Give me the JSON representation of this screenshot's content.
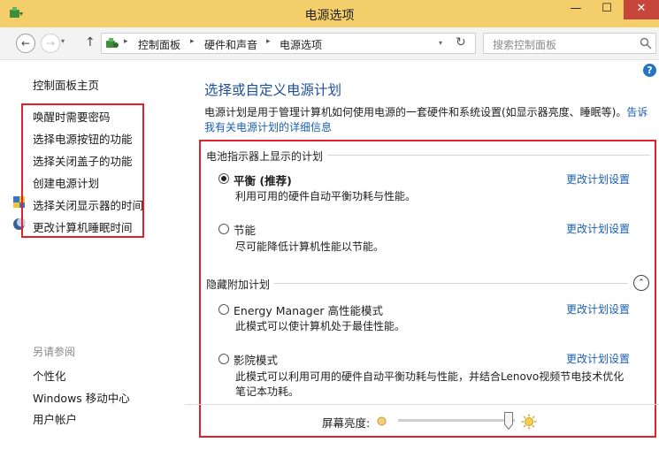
{
  "window": {
    "title": "电源选项",
    "minimize": "—",
    "maximize": "☐",
    "close": "✕"
  },
  "nav": {
    "back": "←",
    "forward": "→",
    "recent": "▾",
    "up": "↑",
    "breadcrumbs": [
      "控制面板",
      "硬件和声音",
      "电源选项"
    ],
    "crumb_separator": "▸",
    "refresh": "↻",
    "address_dropdown": "▾"
  },
  "search": {
    "placeholder": "搜索控制面板"
  },
  "help_label": "?",
  "sidebar": {
    "home": "控制面板主页",
    "tasks": [
      "唤醒时需要密码",
      "选择电源按钮的功能",
      "选择关闭盖子的功能",
      "创建电源计划",
      "选择关闭显示器的时间",
      "更改计算机睡眠时间"
    ],
    "see_also_title": "另请参阅",
    "see_also": [
      "个性化",
      "Windows 移动中心",
      "用户帐户"
    ]
  },
  "main": {
    "title": "选择或自定义电源计划",
    "description_text": "电源计划是用于管理计算机如何使用电源的一套硬件和系统设置(如显示器亮度、睡眠等)。",
    "description_link": "告诉我有关电源计划的详细信息",
    "battery_group_title": "电池指示器上显示的计划",
    "hidden_group_title": "隐藏附加计划",
    "change_link": "更改计划设置",
    "collapse_label": "⌃",
    "plans": [
      {
        "name": "平衡 (推荐)",
        "desc": "利用可用的硬件自动平衡功耗与性能。",
        "checked": true
      },
      {
        "name": "节能",
        "desc": "尽可能降低计算机性能以节能。",
        "checked": false
      },
      {
        "name": "Energy Manager 高性能模式",
        "desc": "此模式可以使计算机处于最佳性能。",
        "checked": false
      },
      {
        "name": "影院模式",
        "desc": "此模式可以利用可用的硬件自动平衡功耗与性能，并结合Lenovo视频节电技术优化笔记本功耗。",
        "checked": false
      }
    ]
  },
  "brightness": {
    "label": "屏幕亮度:",
    "level": 0.95
  },
  "colors": {
    "titlebar": "#f4ce6a",
    "accent_link": "#1a5fb4",
    "highlight_box": "#e0202c",
    "close_button": "#c7463c"
  }
}
